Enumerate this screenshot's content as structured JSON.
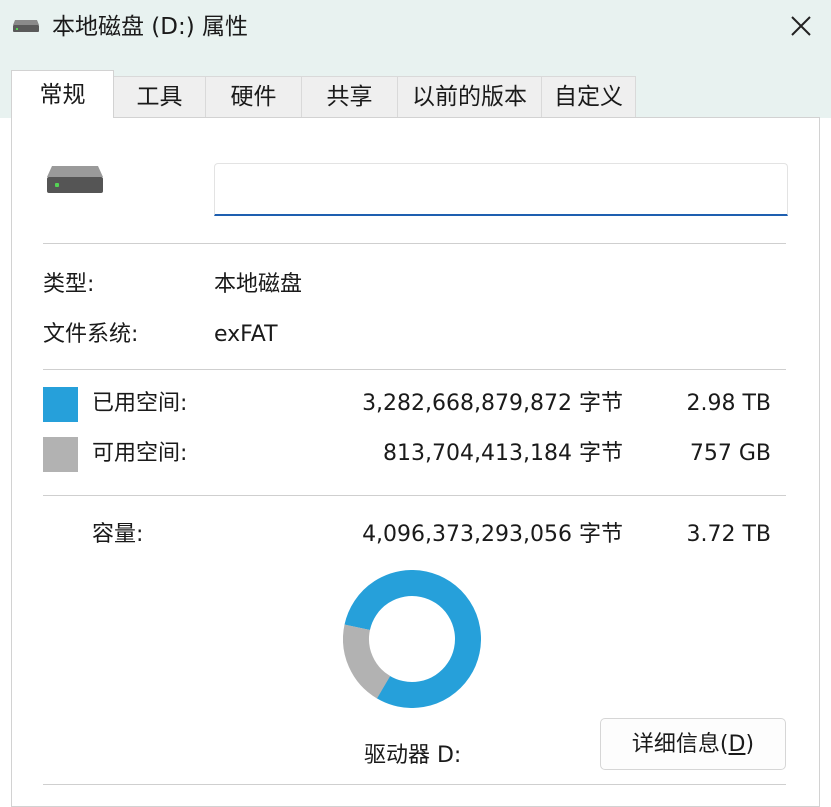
{
  "window": {
    "title": "本地磁盘 (D:) 属性",
    "icon": "drive-icon",
    "close_icon": "close-icon"
  },
  "tabs": [
    {
      "label": "常规",
      "active": true
    },
    {
      "label": "工具",
      "active": false
    },
    {
      "label": "硬件",
      "active": false
    },
    {
      "label": "共享",
      "active": false
    },
    {
      "label": "以前的版本",
      "active": false
    },
    {
      "label": "自定义",
      "active": false
    }
  ],
  "general": {
    "drive_icon": "hard-drive-icon",
    "name_value": "",
    "type_label": "类型:",
    "type_value": "本地磁盘",
    "fs_label": "文件系统:",
    "fs_value": "exFAT",
    "used": {
      "label": "已用空间:",
      "bytes": "3,282,668,879,872 字节",
      "size": "2.98 TB",
      "color": "#26a0da"
    },
    "free": {
      "label": "可用空间:",
      "bytes": "813,704,413,184 字节",
      "size": "757 GB",
      "color": "#b2b2b2"
    },
    "capacity": {
      "label": "容量:",
      "bytes": "4,096,373,293,056 字节",
      "size": "3.72 TB"
    },
    "drive_label": "驱动器 D:",
    "details_button": {
      "label": "详细信息(",
      "accel": "D",
      "suffix": ")"
    }
  },
  "chart_data": {
    "type": "pie",
    "categories": [
      "已用空间",
      "可用空间"
    ],
    "values": [
      3282668879872,
      813704413184
    ],
    "colors": [
      "#26a0da",
      "#b2b2b2"
    ]
  },
  "colors": {
    "titlebar_bg": "#e8f2f0",
    "accent": "#1e5fb0"
  }
}
